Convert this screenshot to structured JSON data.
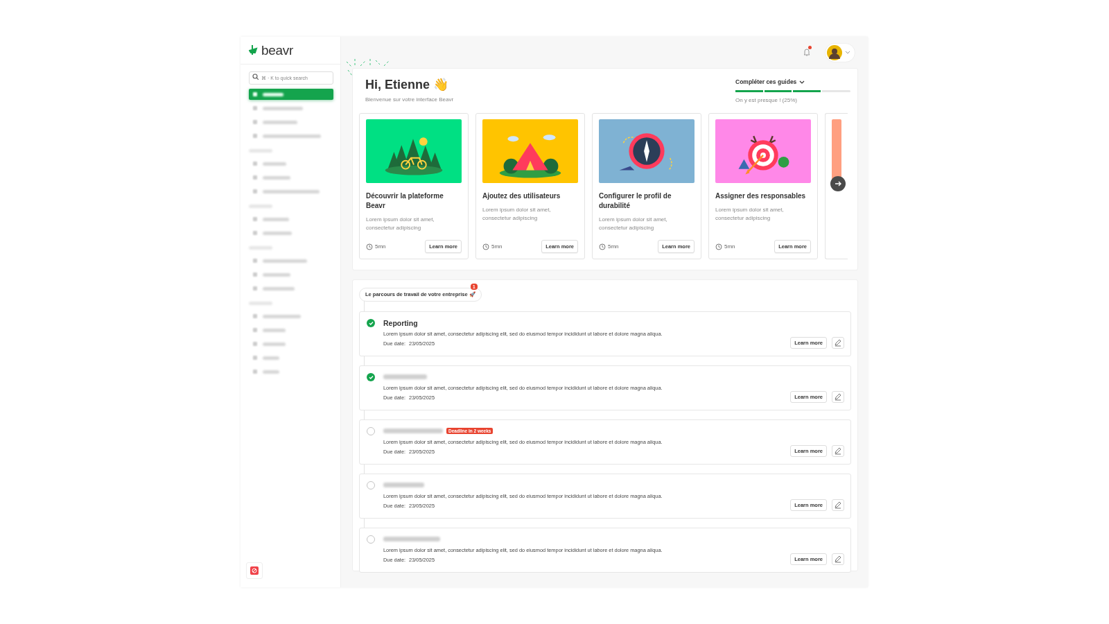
{
  "sidebar": {
    "logo": "beavr",
    "search": {
      "placeholder": "⌘ · K to quick search"
    },
    "items": [
      {
        "kind": "item",
        "selected": true
      },
      {
        "kind": "item",
        "selected": false
      },
      {
        "kind": "item",
        "selected": false
      },
      {
        "kind": "item",
        "selected": false
      },
      {
        "kind": "section"
      },
      {
        "kind": "item",
        "selected": false
      },
      {
        "kind": "item",
        "selected": false
      },
      {
        "kind": "item",
        "selected": false
      },
      {
        "kind": "section"
      },
      {
        "kind": "item",
        "selected": false
      },
      {
        "kind": "item",
        "selected": false
      },
      {
        "kind": "section"
      },
      {
        "kind": "item",
        "selected": false
      },
      {
        "kind": "item",
        "selected": false
      },
      {
        "kind": "item",
        "selected": false
      },
      {
        "kind": "section"
      },
      {
        "kind": "item",
        "selected": false
      },
      {
        "kind": "item",
        "selected": false
      },
      {
        "kind": "item",
        "selected": false
      },
      {
        "kind": "item",
        "selected": false
      },
      {
        "kind": "item",
        "selected": false
      }
    ]
  },
  "header": {
    "unread_notifications": true
  },
  "welcome": {
    "title": "Hi, Etienne 👋",
    "subtitle": "Bienvenue sur votre interface Beavr",
    "guides": {
      "label": "Compléter ces guides",
      "level": 0.75,
      "status": "On y est presque ! (25%)"
    }
  },
  "guide_cards": [
    {
      "kind": "forest",
      "color": "#00e083",
      "title": "Découvrir la plateforme Beavr",
      "description": "Lorem ipsum dolor sit amet, consectetur adipiscing",
      "duration": "5mn",
      "button": "Learn more"
    },
    {
      "kind": "tent",
      "color": "#ffc400",
      "title": "Ajoutez des utilisateurs",
      "description": "Lorem ipsum dolor sit amet, consectetur adipiscing",
      "duration": "5mn",
      "button": "Learn more"
    },
    {
      "kind": "compass",
      "color": "#7fb2d3",
      "title": "Configurer le profil de durabilité",
      "description": "Lorem ipsum dolor sit amet, consectetur adipiscing",
      "duration": "5mn",
      "button": "Learn more"
    },
    {
      "kind": "target",
      "color": "#ff88e8",
      "title": "Assigner des responsables",
      "description": "Lorem ipsum dolor sit amet, consectetur adipiscing",
      "duration": "5mn",
      "button": "Learn more"
    },
    {
      "kind": "partial",
      "color": "#ff9f80"
    }
  ],
  "journey": {
    "title": "Le parcours de travail de votre entreprise 🚀",
    "badge": "1",
    "steps": [
      {
        "title": "Reporting",
        "done": true,
        "description": "Lorem ipsum dolor sit amet, consectetur adipiscing elit, sed do eiusmod tempor incididunt ut labore et dolore magna aliqua.",
        "due_label": "Due date:",
        "due_date": "23/05/2025",
        "button": "Learn more"
      },
      {
        "done": true,
        "description": "Lorem ipsum dolor sit amet, consectetur adipiscing elit, sed do eiusmod tempor incididunt ut labore et dolore magna aliqua.",
        "due_label": "Due date:",
        "due_date": "23/05/2025",
        "button": "Learn more"
      },
      {
        "done": false,
        "deadline": "Deadline in 2 weeks",
        "description": "Lorem ipsum dolor sit amet, consectetur adipiscing elit, sed do eiusmod tempor incididunt ut labore et dolore magna aliqua.",
        "due_label": "Due date:",
        "due_date": "23/05/2025",
        "button": "Learn more"
      },
      {
        "done": false,
        "description": "Lorem ipsum dolor sit amet, consectetur adipiscing elit, sed do eiusmod tempor incididunt ut labore et dolore magna aliqua.",
        "due_label": "Due date:",
        "due_date": "23/05/2025",
        "button": "Learn more"
      },
      {
        "done": false,
        "description": "Lorem ipsum dolor sit amet, consectetur adipiscing elit, sed do eiusmod tempor incididunt ut labore et dolore magna aliqua.",
        "due_label": "Due date:",
        "due_date": "23/05/2025",
        "button": "Learn more"
      }
    ]
  }
}
